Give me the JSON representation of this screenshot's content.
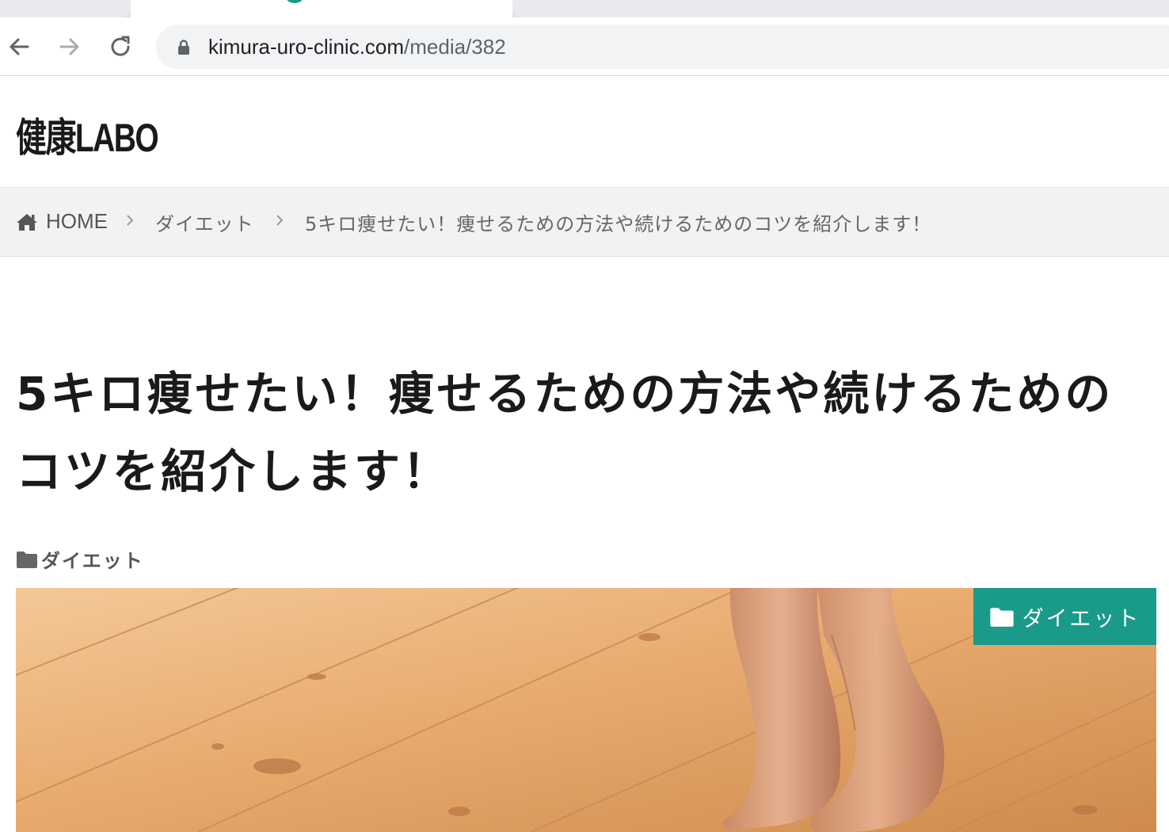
{
  "browser": {
    "url_domain": "kimura-uro-clinic.com",
    "url_path": "/media/382"
  },
  "site": {
    "title": "健康LABO"
  },
  "breadcrumb": {
    "home_label": "HOME",
    "category_label": "ダイエット",
    "current_label": "5キロ痩せたい！痩せるための方法や続けるためのコツを紹介します！"
  },
  "post": {
    "title": "5キロ痩せたい！痩せるための方法や続けるためのコツを紹介します！",
    "category": "ダイエット"
  },
  "hero": {
    "badge_label": "ダイエット"
  },
  "colors": {
    "accent": "#1a9b8a",
    "breadcrumb_bg": "#f2f2f2",
    "text": "#1a1a1a"
  }
}
